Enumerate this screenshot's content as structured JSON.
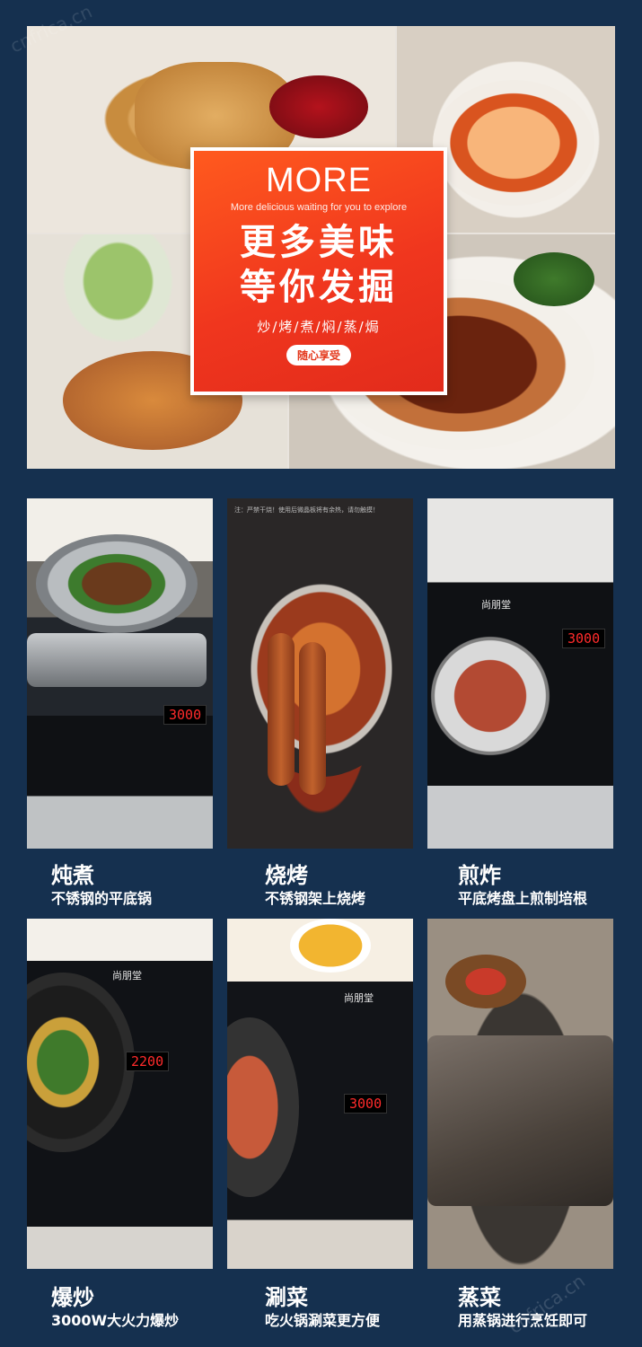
{
  "promo": {
    "headline": "MORE",
    "tagline": "More delicious waiting for you to explore",
    "title_line1": "更多美味",
    "title_line2": "等你发掘",
    "methods": "炒/烤/煮/焖/蒸/焗",
    "badge": "随心享受"
  },
  "cards": [
    {
      "title": "炖煮",
      "subtitle": "不锈钢的平底锅",
      "display": "3000"
    },
    {
      "title": "烧烤",
      "subtitle": "不锈钢架上烧烤",
      "notice": "注：严禁干烧！使用后微晶板将有余热，请勿触摸！"
    },
    {
      "title": "煎炸",
      "subtitle": "平底烤盘上煎制培根",
      "display": "3000",
      "brand": "尚朋堂"
    },
    {
      "title": "爆炒",
      "subtitle": "3000W大火力爆炒",
      "display": "2200",
      "brand": "尚朋堂"
    },
    {
      "title": "涮菜",
      "subtitle": "吃火锅涮菜更方便",
      "display": "3000",
      "brand": "尚朋堂"
    },
    {
      "title": "蒸菜",
      "subtitle": "用蒸锅进行烹饪即可"
    }
  ],
  "watermark": "cnfrica.cn"
}
